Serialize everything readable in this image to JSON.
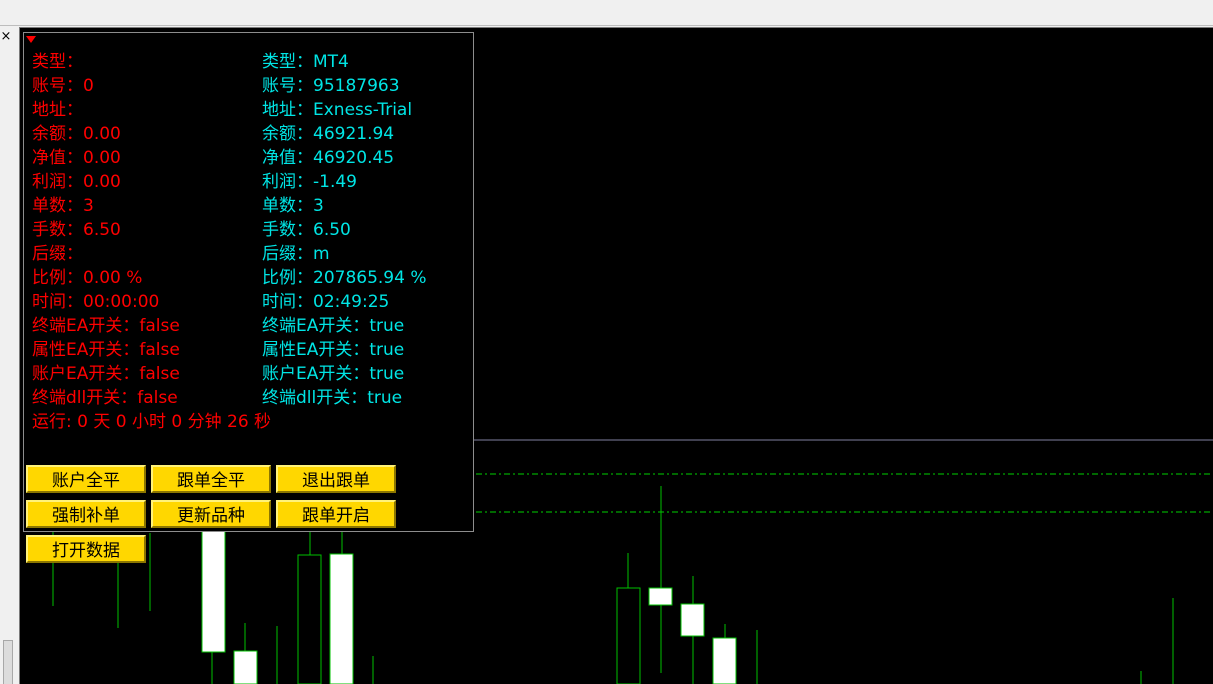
{
  "window": {
    "close_glyph": "×"
  },
  "panel": {
    "local": [
      "类型：",
      "账号：0",
      "地址：",
      "余额：0.00",
      "净值：0.00",
      "利润：0.00",
      "单数：3",
      "手数：6.50",
      "后缀：",
      "比例：0.00 %",
      "时间：00:00:00",
      "终端EA开关：false",
      "属性EA开关：false",
      "账户EA开关：false",
      "终端dll开关：false"
    ],
    "remote": [
      "类型：MT4",
      "账号：95187963",
      "地址：Exness-Trial",
      "余额：46921.94",
      "净值：46920.45",
      "利润：-1.49",
      "单数：3",
      "手数：6.50",
      "后缀：m",
      "比例：207865.94 %",
      "时间：02:49:25",
      "终端EA开关：true",
      "属性EA开关：true",
      "账户EA开关：true",
      "终端dll开关：true"
    ],
    "runtime": "运行: 0 天 0 小时 0 分钟 26 秒"
  },
  "buttons": {
    "close_account": "账户全平",
    "close_follow": "跟单全平",
    "exit_follow": "退出跟单",
    "force_fill": "强制补单",
    "update_symbols": "更新品种",
    "follow_on": "跟单开启",
    "open_data": "打开数据"
  },
  "colors": {
    "chart_bg": "#000000",
    "local_text": "#ff0000",
    "remote_text": "#00e5e5",
    "button_bg": "#ffd700",
    "candle_wick": "#00ff00",
    "candle_body": "#ffffff",
    "level_line": "#00ff00",
    "grid_line": "#8080a0"
  }
}
